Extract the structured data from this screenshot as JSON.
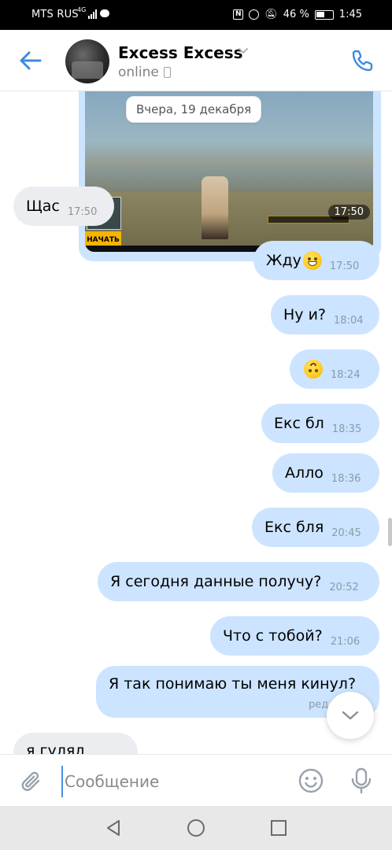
{
  "status_bar": {
    "carrier": "MTS RUS",
    "network": "4G",
    "battery": "46 %",
    "time": "1:45"
  },
  "header": {
    "name": "Excess Excess",
    "status": "online",
    "accent_color": "#3f8ae0"
  },
  "date_separator": "Вчера, 19 декабря",
  "media_message": {
    "time": "17:50",
    "game_button": "НАЧАТЬ"
  },
  "messages": [
    {
      "direction": "in",
      "text": "Щас",
      "time": "17:50"
    },
    {
      "direction": "out",
      "text": "Жду",
      "emoji": "grinning-face",
      "time": "17:50"
    },
    {
      "direction": "out",
      "text": "Ну и?",
      "time": "18:04"
    },
    {
      "direction": "out",
      "text": "",
      "emoji": "upside-down-face",
      "time": "18:24"
    },
    {
      "direction": "out",
      "text": "Екс бл",
      "time": "18:35"
    },
    {
      "direction": "out",
      "text": "Алло",
      "time": "18:36"
    },
    {
      "direction": "out",
      "text": "Екс бля",
      "time": "20:45"
    },
    {
      "direction": "out",
      "text": "Я сегодня данные получу?",
      "time": "20:52"
    },
    {
      "direction": "out",
      "text": "Что с тобой?",
      "time": "21:06"
    },
    {
      "direction": "out",
      "text": "Я так понимаю ты меня кинул?",
      "time": "",
      "edited_label": "ред"
    },
    {
      "direction": "in",
      "text": "я гулял",
      "time": ""
    }
  ],
  "composer": {
    "placeholder": "Сообщение"
  },
  "colors": {
    "outgoing_bubble": "#cce4ff",
    "incoming_bubble": "#ebedf0"
  }
}
